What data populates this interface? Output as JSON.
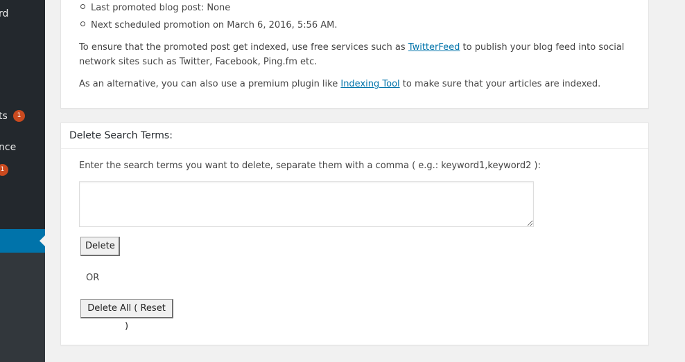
{
  "sidebar": {
    "items": [
      {
        "label": "rd"
      },
      {
        "label": "ts",
        "badge": "1"
      },
      {
        "label": "nce"
      },
      {
        "label": "",
        "badge": "1"
      }
    ],
    "active_color": "#0073aa"
  },
  "promotion": {
    "last_promoted": "Last promoted blog post: None",
    "next_scheduled": "Next scheduled promotion on March 6, 2016, 5:56 AM.",
    "para1_before": "To ensure that the promoted post get indexed, use free services such as ",
    "para1_link": "TwitterFeed",
    "para1_after": " to publish your blog feed into social network sites such as Twitter, Facebook, Ping.fm etc.",
    "para2_before": "As an alternative, you can also use a premium plugin like ",
    "para2_link": "Indexing Tool",
    "para2_after": " to make sure that your articles are indexed."
  },
  "delete_panel": {
    "title": "Delete Search Terms:",
    "instructions": "Enter the search terms you want to delete, separate them with a comma ( e.g.: keyword1,keyword2 ):",
    "textarea_value": "",
    "delete_label": "Delete",
    "or_text": "OR",
    "delete_all_label": "Delete All ( Reset )"
  },
  "colors": {
    "link": "#0073aa",
    "badge": "#ca4a1f",
    "sidebar_bg": "#23282d"
  }
}
